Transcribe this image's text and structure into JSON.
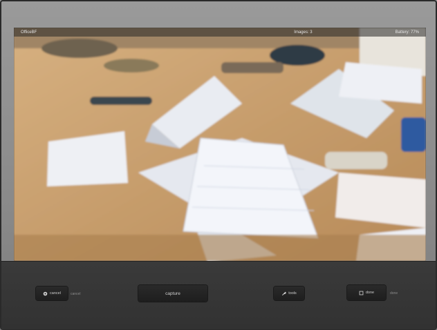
{
  "status": {
    "left": "OfficeBF",
    "images": "Images: 3",
    "battery": "Battery: 77%"
  },
  "controls": {
    "cancel_label": "cancel",
    "cancel_side": "cancel",
    "capture_label": "capture",
    "tools_label": "tools",
    "done_label": "done",
    "done_side": "done"
  },
  "icons": {
    "cancel": "gear-icon",
    "tools": "wrench-icon",
    "done": "square-icon"
  },
  "colors": {
    "table": "#c9a273",
    "bottom_bar": "#353535"
  }
}
